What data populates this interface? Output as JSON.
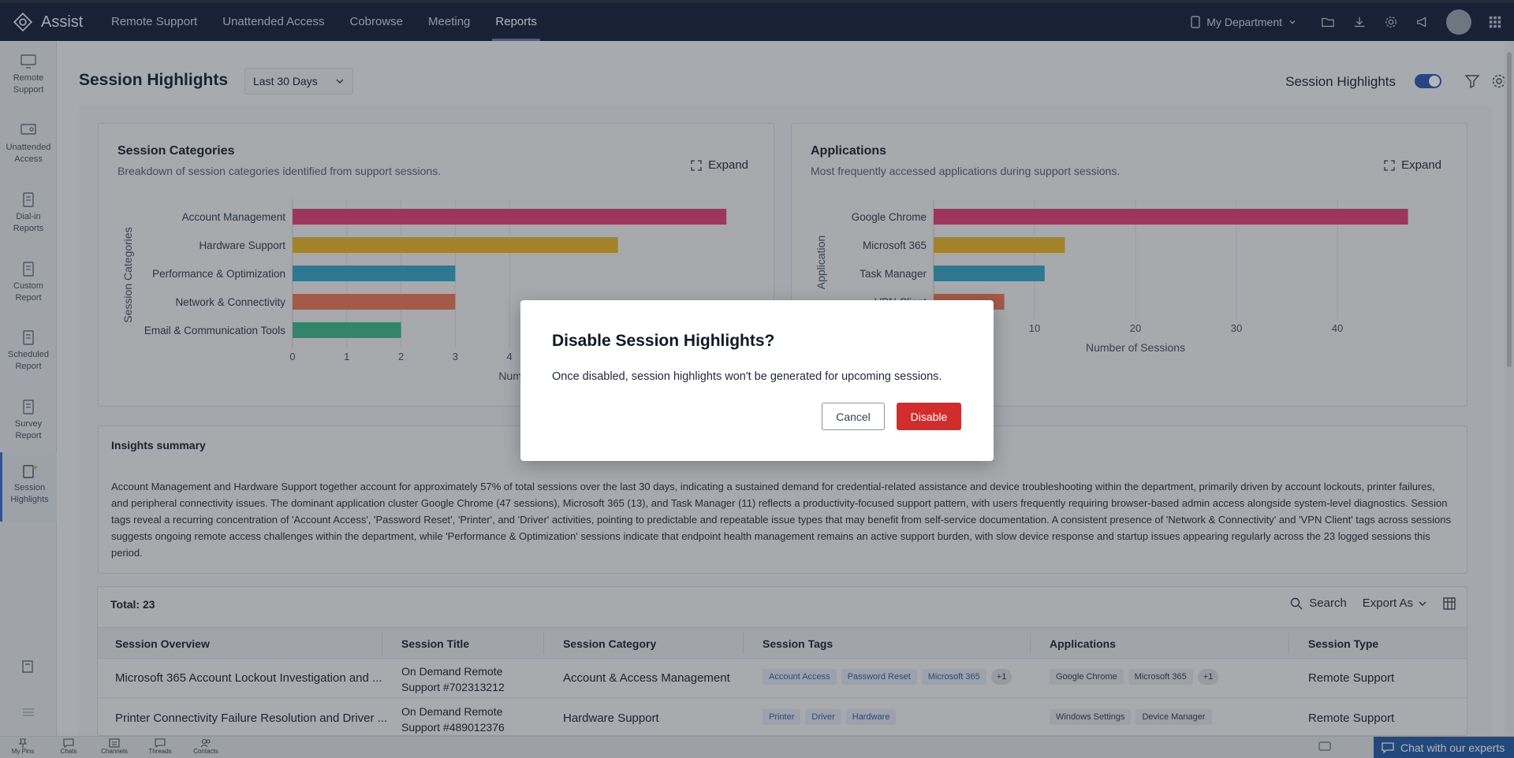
{
  "app": {
    "brand": "Assist"
  },
  "topnav": {
    "tabs": [
      "Remote Support",
      "Unattended Access",
      "Cobrowse",
      "Meeting",
      "Reports"
    ],
    "active_tab": "Reports",
    "department": "My Department",
    "icons": [
      "folder-icon",
      "download-icon",
      "gear-icon",
      "megaphone-icon",
      "avatar",
      "apps-grid-icon"
    ]
  },
  "sidebar": {
    "items": [
      {
        "label_1": "Remote",
        "label_2": "Support",
        "icon": "monitor-icon"
      },
      {
        "label_1": "Unattended",
        "label_2": "Access",
        "icon": "unattended-icon"
      },
      {
        "label_1": "Dial-in",
        "label_2": "Reports",
        "icon": "report-icon"
      },
      {
        "label_1": "Custom",
        "label_2": "Report",
        "icon": "report-icon"
      },
      {
        "label_1": "Scheduled",
        "label_2": "Report",
        "icon": "report-icon"
      },
      {
        "label_1": "Survey",
        "label_2": "Report",
        "icon": "report-icon"
      },
      {
        "label_1": "Session",
        "label_2": "Highlights",
        "icon": "sparkle-report-icon"
      }
    ],
    "active": "Session Highlights"
  },
  "header": {
    "title": "Session Highlights",
    "range": "Last 30 Days",
    "toggle_label": "Session Highlights",
    "toggle_on": true
  },
  "categories_card": {
    "title": "Session Categories",
    "subtitle": "Breakdown of session categories identified from support sessions.",
    "expand": "Expand"
  },
  "applications_card": {
    "title": "Applications",
    "subtitle": "Most frequently accessed applications during support sessions.",
    "expand": "Expand"
  },
  "chart_data": [
    {
      "type": "bar",
      "orientation": "horizontal",
      "categories": [
        "Account Management",
        "Hardware Support",
        "Performance & Optimization",
        "Network & Connectivity",
        "Email & Communication Tools"
      ],
      "values": [
        8,
        6,
        3,
        3,
        2
      ],
      "colors": [
        "#e0457a",
        "#e6b530",
        "#3ba6c8",
        "#e7795c",
        "#43b98c"
      ],
      "ylabel": "Session Categories",
      "xlabel": "Number of",
      "xticks": [
        0,
        1,
        2,
        3,
        4
      ],
      "xlim": [
        0,
        9
      ]
    },
    {
      "type": "bar",
      "orientation": "horizontal",
      "categories": [
        "Google Chrome",
        "Microsoft 365",
        "Task Manager",
        "VPN Client"
      ],
      "values": [
        47,
        13,
        11,
        7
      ],
      "colors": [
        "#e0457a",
        "#e6b530",
        "#3ba6c8",
        "#e7795c"
      ],
      "ylabel": "Application",
      "xlabel": "Number of Sessions",
      "xticks": [
        10,
        20,
        30,
        40
      ],
      "xlim": [
        0,
        50
      ]
    }
  ],
  "insights": {
    "title": "Insights summary",
    "text": "Account Management and Hardware Support together account for approximately 57% of total sessions over the last 30 days, indicating a sustained demand for credential-related assistance and device troubleshooting within the department, primarily driven by account lockouts, printer failures, and peripheral connectivity issues. The dominant application cluster Google Chrome (47 sessions), Microsoft 365 (13), and Task Manager (11) reflects a productivity-focused support pattern, with users frequently requiring browser-based admin access alongside system-level diagnostics. Session tags reveal a recurring concentration of 'Account Access', 'Password Reset', 'Printer', and 'Driver' activities, pointing to predictable and repeatable issue types that may benefit from self-service documentation. A consistent presence of 'Network & Connectivity' and 'VPN Client' tags across sessions suggests ongoing remote access challenges within the department, while 'Performance & Optimization' sessions indicate that endpoint health management remains an active support burden, with slow device response and startup issues appearing regularly across the 23 logged sessions this period."
  },
  "table": {
    "total": "Total: 23",
    "search": "Search",
    "export": "Export As",
    "columns": [
      "Session Overview",
      "Session Title",
      "Session Category",
      "Session Tags",
      "Applications",
      "Session Type"
    ],
    "rows": [
      {
        "overview": "Microsoft 365 Account Lockout Investigation and ...",
        "title_1": "On Demand Remote",
        "title_2": "Support #702313212",
        "category": "Account & Access Management",
        "tags": [
          "Account Access",
          "Password Reset",
          "Microsoft 365"
        ],
        "tags_more": "+1",
        "apps": [
          "Google Chrome",
          "Microsoft 365"
        ],
        "apps_more": "+1",
        "type": "Remote Support"
      },
      {
        "overview": "Printer Connectivity Failure Resolution and Driver ...",
        "title_1": "On Demand Remote",
        "title_2": "Support #489012376",
        "category": "Hardware Support",
        "tags": [
          "Printer",
          "Driver",
          "Hardware"
        ],
        "tags_more": "",
        "apps": [
          "Windows Settings",
          "Device Manager"
        ],
        "apps_more": "",
        "type": "Remote Support"
      }
    ]
  },
  "bottombar": {
    "items": [
      "My Pins",
      "Chats",
      "Channels",
      "Threads",
      "Contacts"
    ],
    "chat": "Chat with our experts"
  },
  "modal": {
    "title": "Disable Session Highlights?",
    "message": "Once disabled, session highlights won't be generated for upcoming sessions.",
    "cancel": "Cancel",
    "confirm": "Disable"
  }
}
